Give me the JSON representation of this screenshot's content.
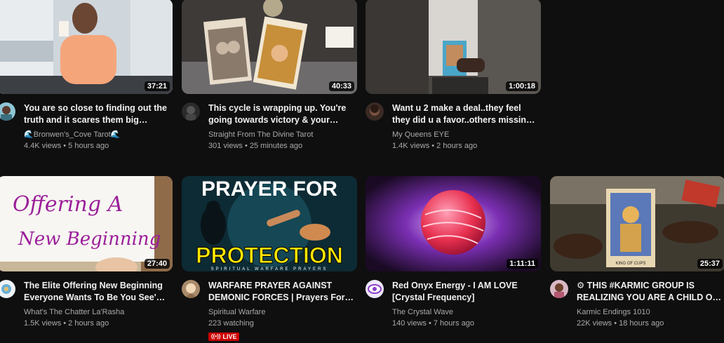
{
  "videos": [
    {
      "title": "You are so close to finding out the truth and it scares them big…",
      "channel": "🌊Bronwen's_Cove Tarot🌊",
      "stats": "4.4K views • 5 hours ago",
      "duration": "37:21"
    },
    {
      "title": "This cycle is wrapping up. You're going towards victory & your…",
      "channel": "Straight From The Divine Tarot",
      "stats": "301 views • 25 minutes ago",
      "duration": "40:33"
    },
    {
      "title": "Want u 2 make a deal..they feel they did u a favor..others missin…",
      "channel": "My Queens EYE",
      "stats": "1.4K views • 2 hours ago",
      "duration": "1:00:18"
    },
    {
      "title": "The Elite Offering New Beginning Everyone Wants To Be You See'…",
      "channel": "What's The Chatter La'Rasha",
      "stats": "1.5K views • 2 hours ago",
      "duration": "27:40",
      "thumb_text": [
        "Offering A",
        "New Beginning"
      ]
    },
    {
      "title": "WARFARE PRAYER AGAINST DEMONIC FORCES | Prayers For…",
      "channel": "Spiritual Warfare",
      "stats": "223 watching",
      "live_label": "LIVE",
      "thumb_text": [
        "PRAYER FOR",
        "PROTECTION",
        "SPIRITUAL WARFARE PRAYERS"
      ]
    },
    {
      "title": "Red Onyx Energy - I AM LOVE [Crystal Frequency]",
      "channel": "The Crystal Wave",
      "stats": "140 views • 7 hours ago",
      "duration": "1:11:11"
    },
    {
      "title": "⚙ THIS #KARMIC GROUP IS REALIZING YOU ARE A CHILD O…",
      "channel": "Karmic Endings 1010",
      "stats": "22K views • 18 hours ago",
      "duration": "25:37",
      "thumb_text": [
        "KING OF CUPS"
      ]
    }
  ],
  "colors": {
    "background": "#0f0f0f",
    "title": "#f1f1f1",
    "secondary": "#aaaaaa",
    "live": "#cc0000"
  }
}
